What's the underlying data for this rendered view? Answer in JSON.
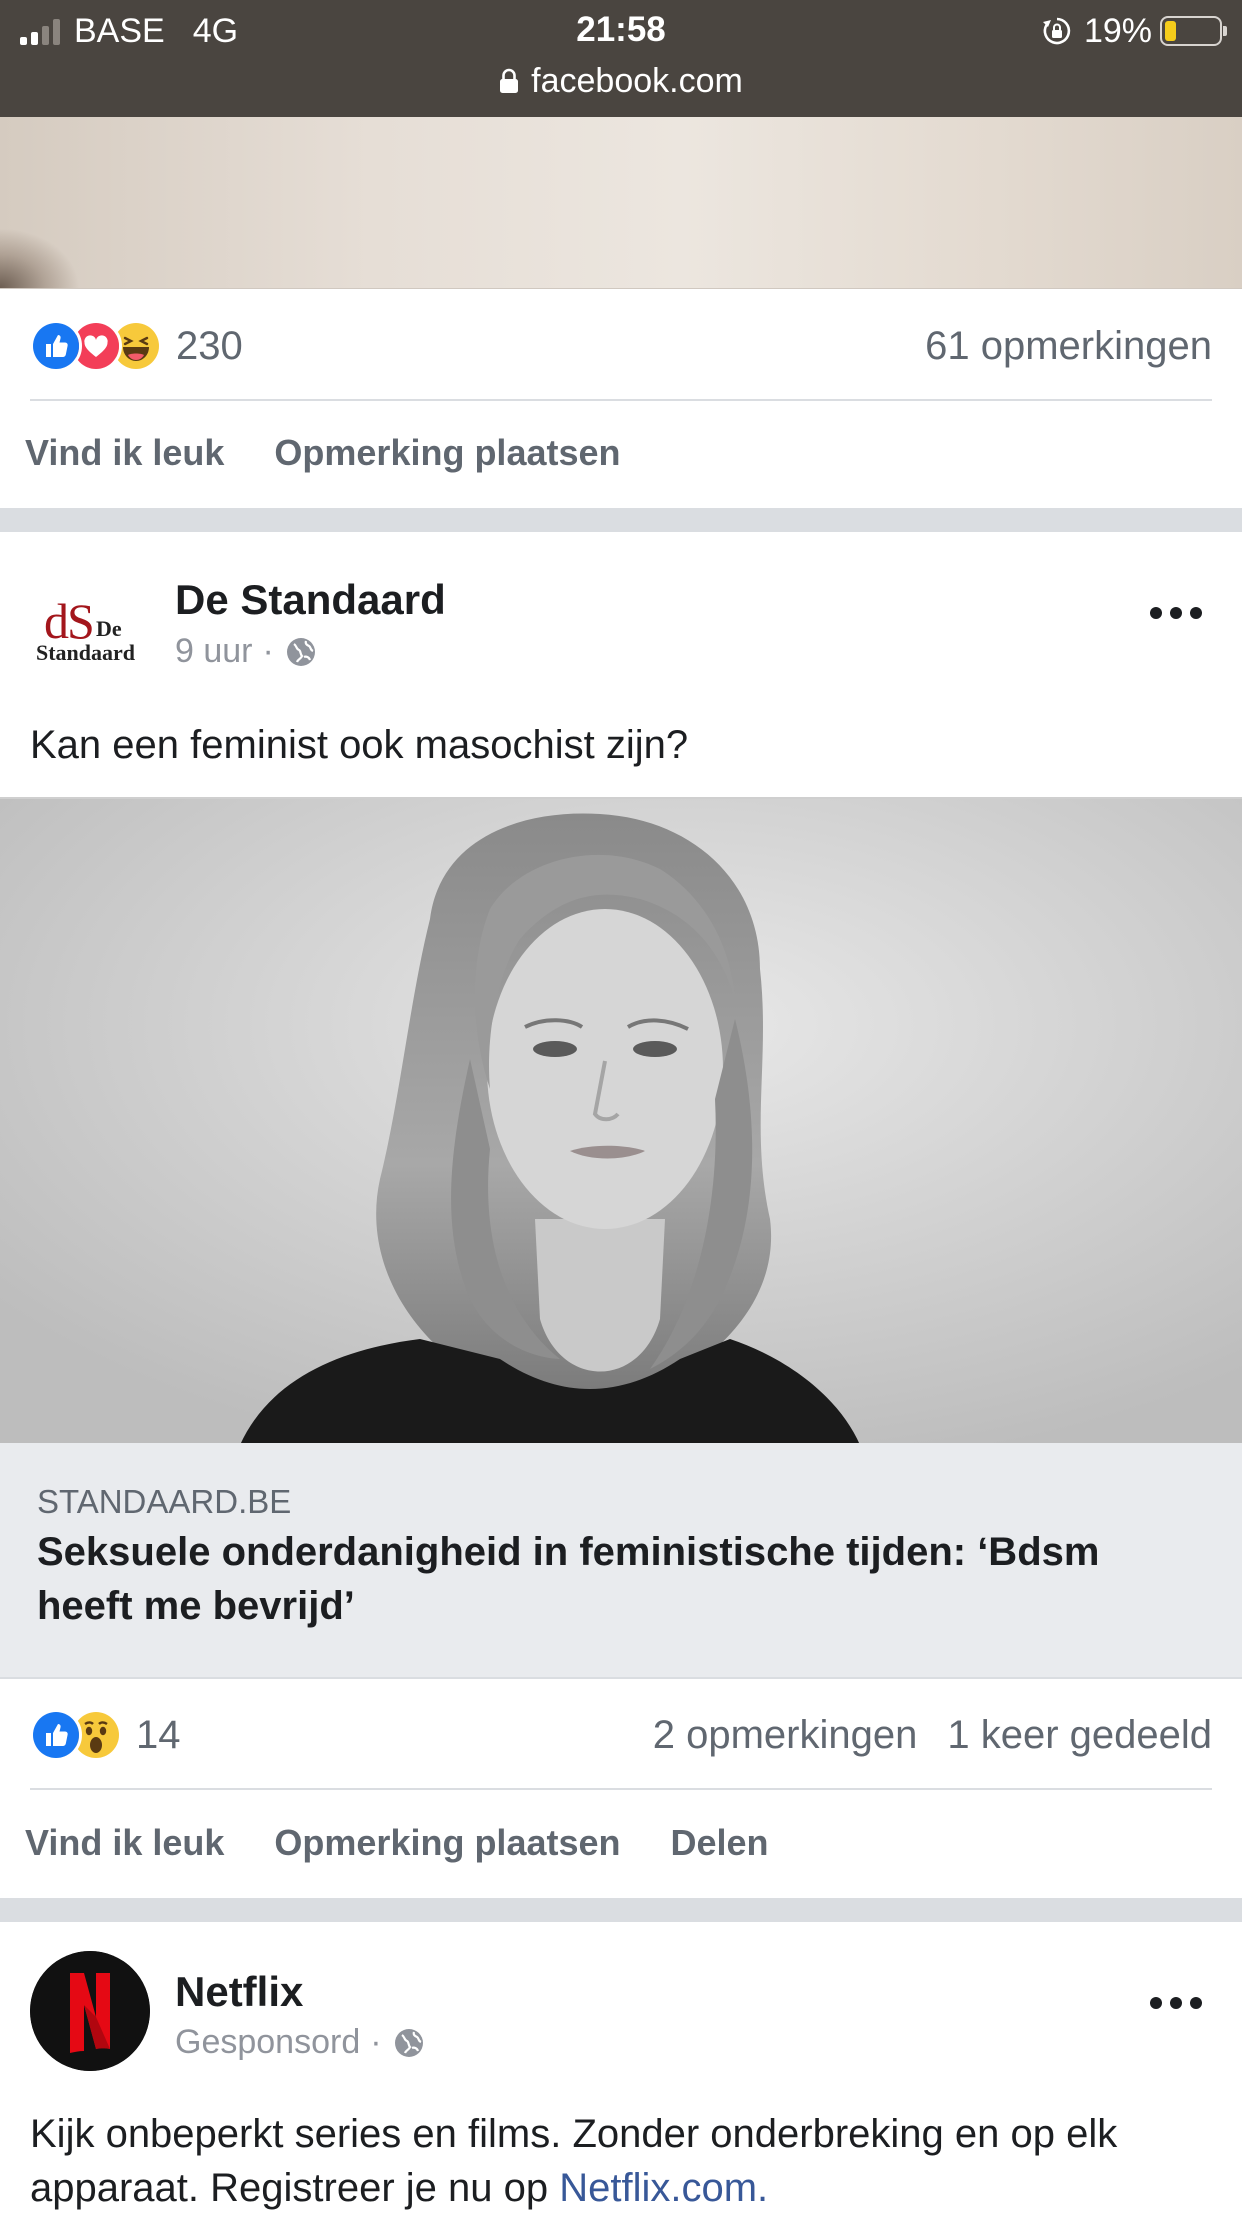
{
  "status_bar": {
    "carrier": "BASE",
    "network": "4G",
    "time": "21:58",
    "battery_percent": "19%",
    "battery_level": 0.19,
    "url": "facebook.com"
  },
  "post1": {
    "reaction_count": "230",
    "comments": "61 opmerkingen",
    "reactions": [
      "like-icon",
      "love-icon",
      "haha-icon"
    ],
    "actions": {
      "like": "Vind ik leuk",
      "comment": "Opmerking plaatsen"
    }
  },
  "post2": {
    "author": "De Standaard",
    "logo": {
      "ds": "dS",
      "de": "De",
      "standaard": "Standaard"
    },
    "time": "9 uur",
    "separator_dot": "·",
    "text": "Kan een feminist ook masochist zijn?",
    "link": {
      "domain": "STANDAARD.BE",
      "title": "Seksuele onderdanigheid in feministische tijden: ‘Bdsm heeft me bevrijd’"
    },
    "reactions": [
      "like-icon",
      "wow-icon"
    ],
    "reaction_count": "14",
    "comments": "2 opmerkingen",
    "shares": "1 keer gedeeld",
    "actions": {
      "like": "Vind ik leuk",
      "comment": "Opmerking plaatsen",
      "share": "Delen"
    }
  },
  "post3": {
    "author": "Netflix",
    "meta": "Gesponsord",
    "separator_dot": "·",
    "text": "Kijk onbeperkt series en films. Zonder onderbreking en op elk apparaat. Registreer je nu op ",
    "link_text": "Netflix.com."
  },
  "colors": {
    "status_bar": "#4a4540",
    "like_blue": "#1877f2",
    "love_red": "#f33e58",
    "link_blue": "#385898",
    "separator": "#dadde1",
    "netflix_red": "#e50914"
  }
}
